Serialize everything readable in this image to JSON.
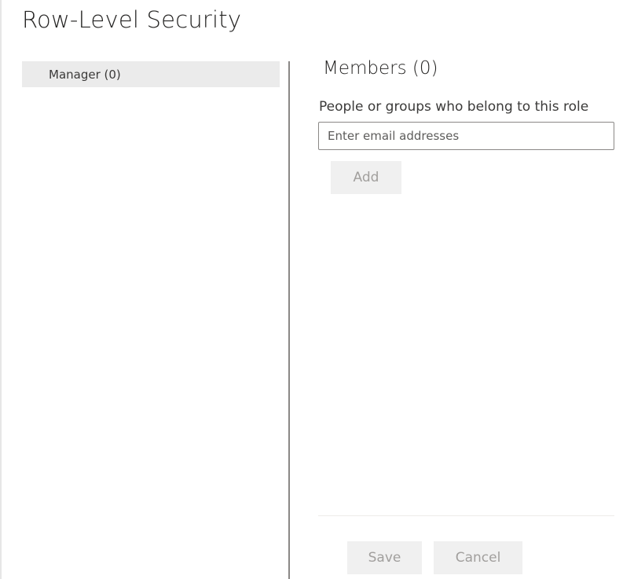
{
  "dialog": {
    "title": "Row-Level Security"
  },
  "roles": {
    "items": [
      {
        "label": "Manager (0)",
        "selected": true
      }
    ]
  },
  "members": {
    "heading": "Members (0)",
    "field_label": "People or groups who belong to this role",
    "email_input": {
      "placeholder": "Enter email addresses",
      "value": ""
    },
    "add_label": "Add"
  },
  "footer": {
    "save_label": "Save",
    "cancel_label": "Cancel"
  },
  "colors": {
    "selected_role_bg": "#ebebeb",
    "divider": "#8a8886",
    "disabled_button_bg": "#f0f0f0",
    "disabled_button_text": "#a19f9d"
  }
}
